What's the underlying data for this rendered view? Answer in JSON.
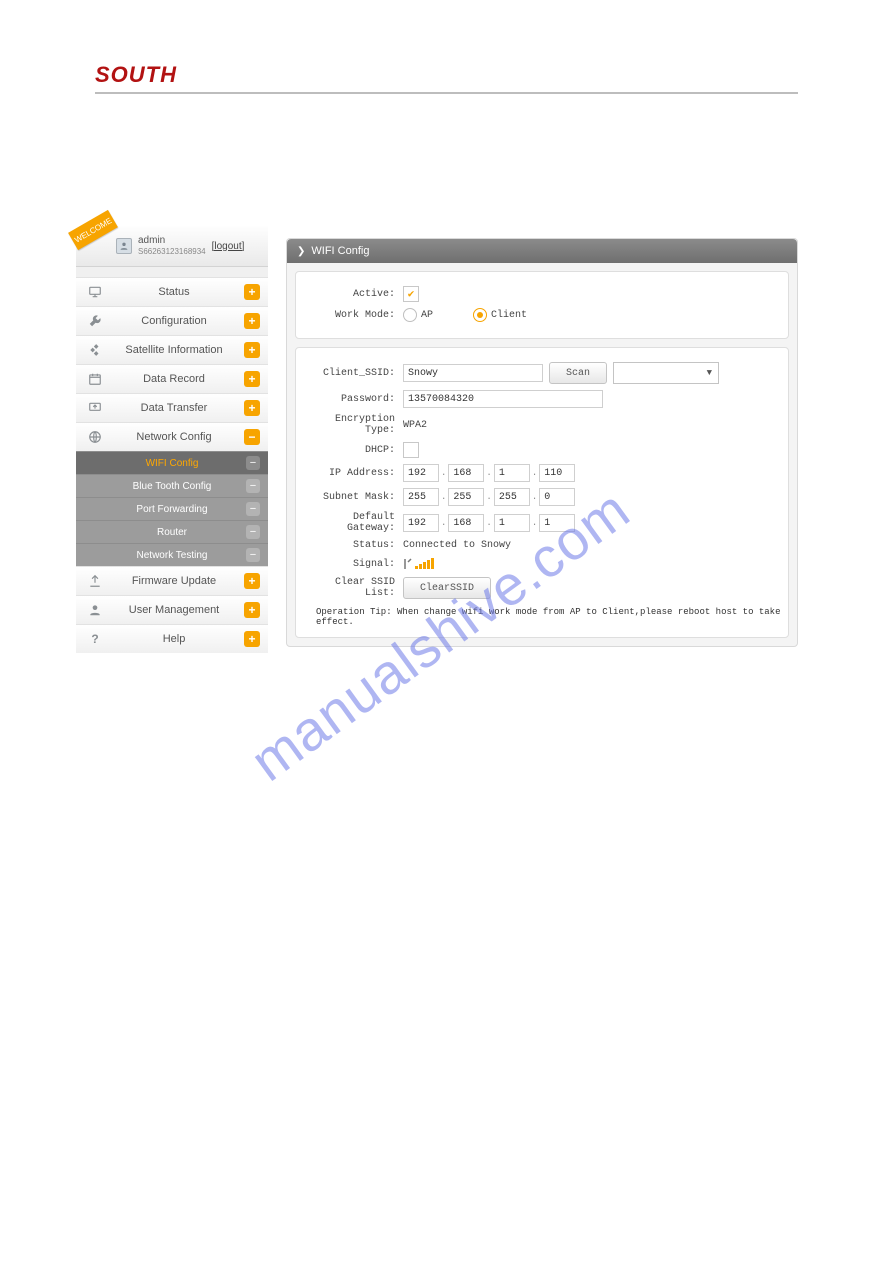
{
  "brand": "SOUTH",
  "watermark": "manualshive.com",
  "user": {
    "welcome_ribbon": "WELCOME",
    "name": "admin",
    "id": "S66263123168934",
    "logout": "[logout]"
  },
  "sidebar": {
    "items": [
      {
        "icon": "monitor",
        "label": "Status",
        "badge": "plus"
      },
      {
        "icon": "wrench",
        "label": "Configuration",
        "badge": "plus"
      },
      {
        "icon": "sat",
        "label": "Satellite Information",
        "badge": "plus"
      },
      {
        "icon": "calendar",
        "label": "Data Record",
        "badge": "plus"
      },
      {
        "icon": "transfer",
        "label": "Data Transfer",
        "badge": "plus"
      },
      {
        "icon": "globe",
        "label": "Network Config",
        "badge": "minus"
      },
      {
        "icon": "upload",
        "label": "Firmware Update",
        "badge": "plus"
      },
      {
        "icon": "user",
        "label": "User Management",
        "badge": "plus"
      },
      {
        "icon": "help",
        "label": "Help",
        "badge": "plus"
      }
    ],
    "subitems": [
      {
        "label": "WIFI Config",
        "active": true
      },
      {
        "label": "Blue Tooth Config",
        "active": false
      },
      {
        "label": "Port Forwarding",
        "active": false
      },
      {
        "label": "Router",
        "active": false
      },
      {
        "label": "Network Testing",
        "active": false
      }
    ]
  },
  "content": {
    "title": "WIFI Config",
    "labels": {
      "active": "Active:",
      "work_mode": "Work Mode:",
      "ap": "AP",
      "client": "Client",
      "client_ssid": "Client_SSID:",
      "scan": "Scan",
      "password": "Password:",
      "encryption_type": "Encryption Type:",
      "dhcp": "DHCP:",
      "ip_address": "IP Address:",
      "subnet_mask": "Subnet Mask:",
      "default_gateway": "Default Gateway:",
      "status": "Status:",
      "signal": "Signal:",
      "clear_ssid_list": "Clear SSID List:",
      "clear_ssid_btn": "ClearSSID",
      "operation_tip": "Operation Tip: When change wifi work mode from AP to Client,please reboot host to take effect."
    },
    "values": {
      "active_checked": true,
      "work_mode": "Client",
      "client_ssid": "Snowy",
      "password": "13570084320",
      "encryption_type": "WPA2",
      "dhcp_checked": false,
      "ip": [
        "192",
        "168",
        "1",
        "110"
      ],
      "mask": [
        "255",
        "255",
        "255",
        "0"
      ],
      "gw": [
        "192",
        "168",
        "1",
        "1"
      ],
      "status": "Connected to Snowy"
    }
  }
}
